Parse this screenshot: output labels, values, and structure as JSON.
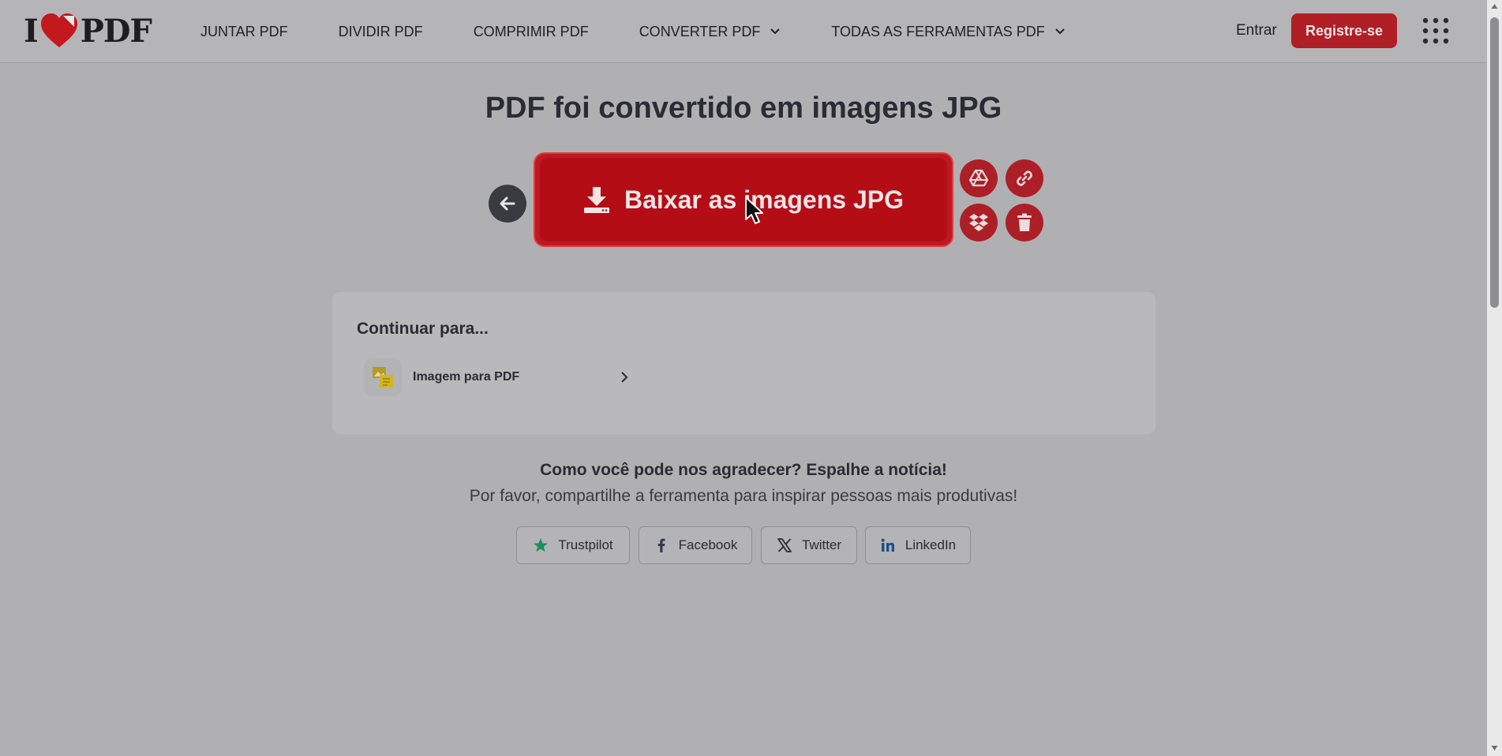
{
  "header": {
    "logo_left": "I",
    "logo_right": "PDF",
    "nav": [
      {
        "label": "JUNTAR PDF",
        "dropdown": false
      },
      {
        "label": "DIVIDIR PDF",
        "dropdown": false
      },
      {
        "label": "COMPRIMIR PDF",
        "dropdown": false
      },
      {
        "label": "CONVERTER PDF",
        "dropdown": true
      },
      {
        "label": "TODAS AS FERRAMENTAS PDF",
        "dropdown": true
      }
    ],
    "login_label": "Entrar",
    "register_label": "Registre-se"
  },
  "main": {
    "title": "PDF foi convertido em imagens JPG",
    "download_label": "Baixar as imagens JPG",
    "side_actions": [
      "google-drive-icon",
      "link-icon",
      "dropbox-icon",
      "trash-icon"
    ]
  },
  "continue": {
    "title": "Continuar para...",
    "tools": [
      {
        "label": "Imagem para PDF",
        "icon": "image-to-pdf-icon"
      }
    ]
  },
  "share": {
    "question": "Como você pode nos agradecer? Espalhe a notícia!",
    "subtitle": "Por favor, compartilhe a ferramenta para inspirar pessoas mais produtivas!",
    "buttons": [
      {
        "label": "Trustpilot",
        "icon": "trustpilot-star-icon"
      },
      {
        "label": "Facebook",
        "icon": "facebook-icon"
      },
      {
        "label": "Twitter",
        "icon": "x-icon"
      },
      {
        "label": "LinkedIn",
        "icon": "linkedin-icon"
      }
    ]
  },
  "colors": {
    "brand_red": "#b40d15",
    "overlay_bg": "#b0afb2"
  }
}
